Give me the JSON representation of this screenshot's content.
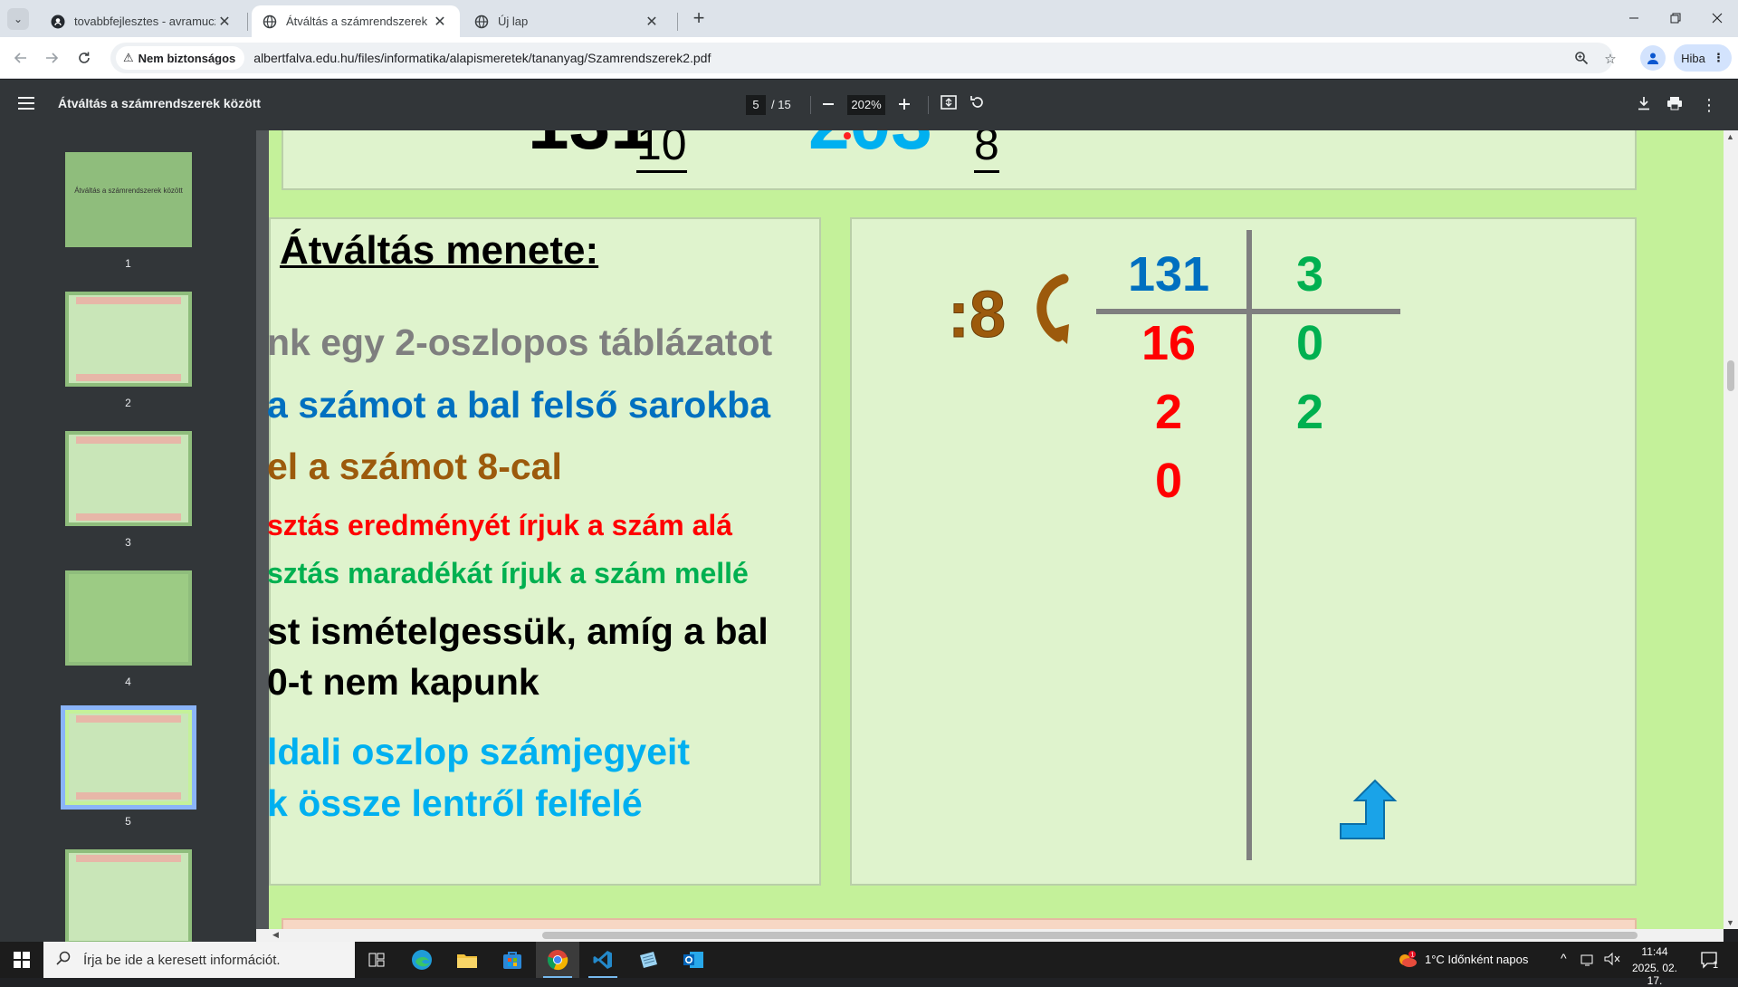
{
  "browser": {
    "tabs": [
      {
        "title": "tovabbfejlesztes - avramuczpist",
        "favicon": "github-icon",
        "active": false
      },
      {
        "title": "Átváltás a számrendszerek közö",
        "favicon": "globe-icon",
        "active": true
      },
      {
        "title": "Új lap",
        "favicon": "globe-icon",
        "active": false
      }
    ],
    "security_label": "Nem biztonságos",
    "url": "albertfalva.edu.hu/files/informatika/alapismeretek/tananyag/Szamrendszerek2.pdf",
    "profile_button": "Hiba"
  },
  "pdf": {
    "title": "Átváltás a számrendszerek között",
    "current_page": "5",
    "total_pages": "/ 15",
    "zoom": "202%",
    "thumbnails": [
      "1",
      "2",
      "3",
      "4",
      "5"
    ],
    "thumb1_text": "Átváltás a számrendszerek között",
    "selected_thumbnail": "5"
  },
  "slide": {
    "top_subscript_10": "10",
    "top_subscript_8": "8",
    "heading": "Átváltás menete:",
    "steps": [
      {
        "text": "nk egy 2-oszlopos táblázatot",
        "color": "#7f7f7f"
      },
      {
        "text": "a számot a bal felső sarokba",
        "color": "#0070c0"
      },
      {
        "text": "el a számot 8-cal",
        "color": "#9c5a0c"
      },
      {
        "text": "sztás eredményét írjuk a szám alá",
        "color": "#ff0000"
      },
      {
        "text": "sztás maradékát  írjuk a szám mellé",
        "color": "#00b050"
      },
      {
        "text": "st ismételgessük, amíg a bal",
        "color": "#000000"
      },
      {
        "text": "0-t nem kapunk",
        "color": "#000000"
      },
      {
        "text": "ldali oszlop számjegyeit",
        "color": "#00b0f0"
      },
      {
        "text": "k össze lentről felfelé",
        "color": "#00b0f0"
      }
    ],
    "divisor": ":8",
    "table": {
      "left": [
        "131",
        "16",
        "2",
        "0"
      ],
      "right": [
        "3",
        "0",
        "2"
      ]
    },
    "colors": {
      "quotient_head": "#0070c0",
      "quotient": "#ff0000",
      "remainder": "#00b050",
      "divisor": "#9c5a0c"
    }
  },
  "taskbar": {
    "search_placeholder": "Írja be ide a keresett információt.",
    "weather": "1°C  Időnként napos",
    "time": "11:44",
    "date": "2025. 02. 17.",
    "notifications": "1"
  }
}
